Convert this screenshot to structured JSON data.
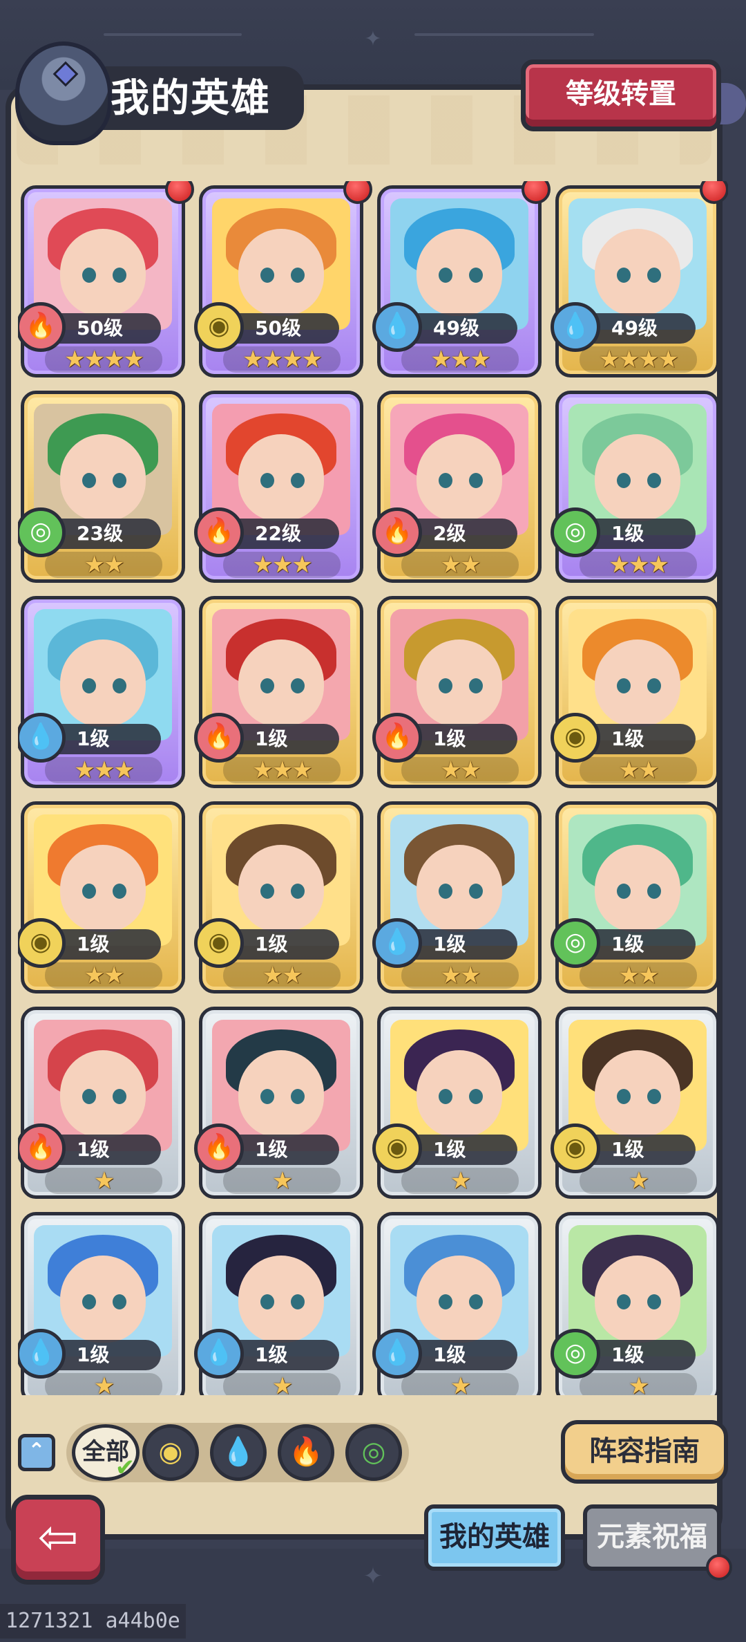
{
  "header": {
    "title": "我的英雄",
    "transfer_label": "等级转置"
  },
  "element_icons": {
    "fire": "flame-icon",
    "water": "water-drop-icon",
    "earth": "earth-swirl-icon",
    "wind": "wind-swirl-icon"
  },
  "heroes": [
    {
      "level": "50级",
      "stars": 4,
      "element": "fire",
      "frame": "purple",
      "alert": true,
      "hair": "#e04a56",
      "bg": "#f4b6c5"
    },
    {
      "level": "50级",
      "stars": 4,
      "element": "earth",
      "frame": "purple",
      "alert": true,
      "hair": "#e98a3a",
      "bg": "#ffd56a"
    },
    {
      "level": "49级",
      "stars": 3,
      "element": "water",
      "frame": "purple",
      "alert": true,
      "hair": "#3aa5de",
      "bg": "#8fd3ef"
    },
    {
      "level": "49级",
      "stars": 4,
      "element": "water",
      "frame": "gold",
      "alert": true,
      "hair": "#eaeaea",
      "bg": "#a4dff1"
    },
    {
      "level": "23级",
      "stars": 2,
      "element": "wind",
      "frame": "gold",
      "alert": false,
      "hair": "#3e9a52",
      "bg": "#d8c3a0"
    },
    {
      "level": "22级",
      "stars": 3,
      "element": "fire",
      "frame": "purple",
      "alert": false,
      "hair": "#e2462e",
      "bg": "#f49db0"
    },
    {
      "level": "2级",
      "stars": 2,
      "element": "fire",
      "frame": "gold",
      "alert": false,
      "hair": "#e4508d",
      "bg": "#f6a7b9"
    },
    {
      "level": "1级",
      "stars": 3,
      "element": "wind",
      "frame": "purple",
      "alert": false,
      "hair": "#7cc99a",
      "bg": "#a9e5b5"
    },
    {
      "level": "1级",
      "stars": 3,
      "element": "water",
      "frame": "purple",
      "alert": false,
      "hair": "#5bb7d8",
      "bg": "#8fdaf0"
    },
    {
      "level": "1级",
      "stars": 3,
      "element": "fire",
      "frame": "gold",
      "alert": false,
      "hair": "#c8302e",
      "bg": "#f4a7ae"
    },
    {
      "level": "1级",
      "stars": 2,
      "element": "fire",
      "frame": "gold",
      "alert": false,
      "hair": "#c79a2f",
      "bg": "#f2a0a8"
    },
    {
      "level": "1级",
      "stars": 2,
      "element": "earth",
      "frame": "gold",
      "alert": false,
      "hair": "#ec8a2c",
      "bg": "#ffe08a"
    },
    {
      "level": "1级",
      "stars": 2,
      "element": "earth",
      "frame": "gold",
      "alert": false,
      "hair": "#ef7a2f",
      "bg": "#ffe17b"
    },
    {
      "level": "1级",
      "stars": 2,
      "element": "earth",
      "frame": "gold",
      "alert": false,
      "hair": "#6d4b2c",
      "bg": "#ffe08a"
    },
    {
      "level": "1级",
      "stars": 2,
      "element": "water",
      "frame": "gold",
      "alert": false,
      "hair": "#7a5634",
      "bg": "#b1def0"
    },
    {
      "level": "1级",
      "stars": 2,
      "element": "wind",
      "frame": "gold",
      "alert": false,
      "hair": "#4fb78a",
      "bg": "#aee6c1"
    },
    {
      "level": "1级",
      "stars": 1,
      "element": "fire",
      "frame": "silver",
      "alert": false,
      "hair": "#d5444b",
      "bg": "#f3a7b0"
    },
    {
      "level": "1级",
      "stars": 1,
      "element": "fire",
      "frame": "silver",
      "alert": false,
      "hair": "#233a47",
      "bg": "#f3a7b0"
    },
    {
      "level": "1级",
      "stars": 1,
      "element": "earth",
      "frame": "silver",
      "alert": false,
      "hair": "#3b2552",
      "bg": "#ffe07a"
    },
    {
      "level": "1级",
      "stars": 1,
      "element": "earth",
      "frame": "silver",
      "alert": false,
      "hair": "#4a3425",
      "bg": "#ffe07a"
    },
    {
      "level": "1级",
      "stars": 1,
      "element": "water",
      "frame": "silver",
      "alert": false,
      "hair": "#3f7fd8",
      "bg": "#a9dcf3"
    },
    {
      "level": "1级",
      "stars": 1,
      "element": "water",
      "frame": "silver",
      "alert": false,
      "hair": "#26243f",
      "bg": "#a9dcf3"
    },
    {
      "level": "1级",
      "stars": 1,
      "element": "water",
      "frame": "silver",
      "alert": false,
      "hair": "#4b8fd6",
      "bg": "#a9dcf3"
    },
    {
      "level": "1级",
      "stars": 1,
      "element": "wind",
      "frame": "silver",
      "alert": false,
      "hair": "#3b2f4d",
      "bg": "#b9e7a5"
    }
  ],
  "filters": {
    "all_label": "全部",
    "elements": [
      "earth",
      "water",
      "fire",
      "wind"
    ]
  },
  "guide_label": "阵容指南",
  "tabs": [
    {
      "label": "我的英雄"
    },
    {
      "label": "元素祝福"
    }
  ],
  "debug_text": "1271321 a44b0e"
}
